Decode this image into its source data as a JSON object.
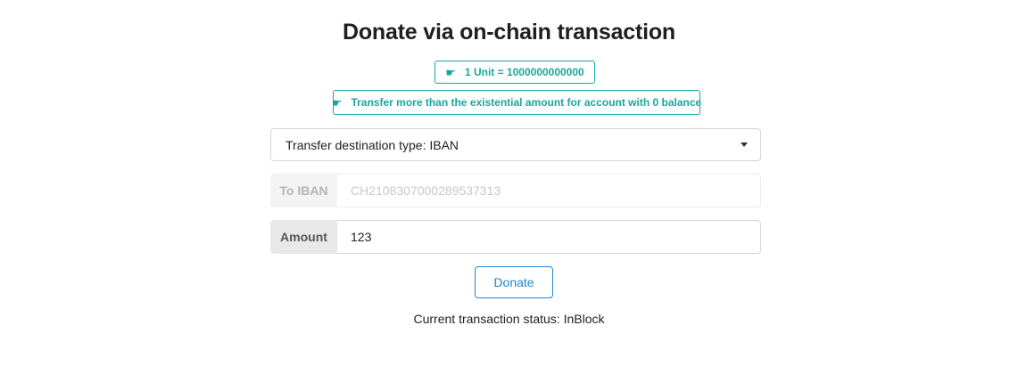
{
  "page": {
    "title": "Donate via on-chain transaction"
  },
  "tags": {
    "unit_text": "1 Unit = 1000000000000",
    "transfer_text": "Transfer more than the existential amount for account with 0 balance",
    "icon": "pointing-hand-icon",
    "color": "#1aa6a0"
  },
  "destination_select": {
    "selected": "Transfer destination type: IBAN"
  },
  "iban_field": {
    "label": "To IBAN",
    "placeholder": "CH2108307000289537313",
    "value": "",
    "disabled": true
  },
  "amount_field": {
    "label": "Amount",
    "value": "123"
  },
  "donate_button": {
    "label": "Donate",
    "color": "#2185d0"
  },
  "status": {
    "text": "Current transaction status: InBlock"
  }
}
